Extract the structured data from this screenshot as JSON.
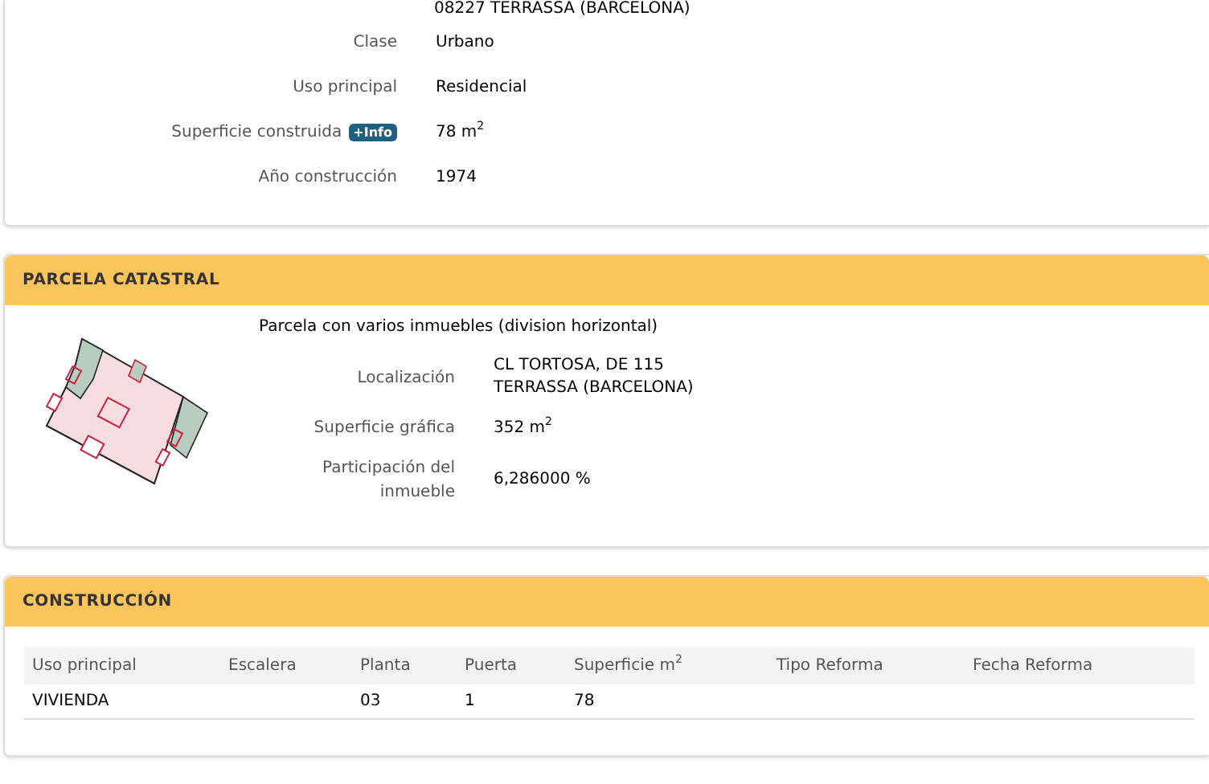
{
  "inmueble": {
    "address_line": "08227 TERRASSA (BARCELONA)",
    "fields": [
      {
        "label": "Clase",
        "value": "Urbano"
      },
      {
        "label": "Uso principal",
        "value": "Residencial"
      },
      {
        "label": "Superficie construida",
        "badge": "+Info",
        "value": "78 m$^{2}$"
      },
      {
        "label": "Año construcción",
        "value": "1974"
      }
    ]
  },
  "parcela": {
    "title": "PARCELA CATASTRAL",
    "description": "Parcela con varios inmuebles (division horizontal)",
    "fields": [
      {
        "label": "Localización",
        "value_lines": [
          "CL TORTOSA, DE 115",
          "TERRASSA (BARCELONA)"
        ]
      },
      {
        "label": "Superficie gráfica",
        "value_lines": [
          "352 m$^{2}$"
        ]
      },
      {
        "label": "Participación del inmueble",
        "value_lines": [
          "6,286000 %"
        ]
      }
    ]
  },
  "construccion": {
    "title": "CONSTRUCCIÓN",
    "table": {
      "columns": [
        "Uso principal",
        "Escalera",
        "Planta",
        "Puerta",
        "Superficie m$^{2}$",
        "Tipo Reforma",
        "Fecha Reforma"
      ],
      "rows": [
        [
          "VIVIENDA",
          "",
          "03",
          "1",
          "78",
          "",
          ""
        ]
      ]
    }
  }
}
